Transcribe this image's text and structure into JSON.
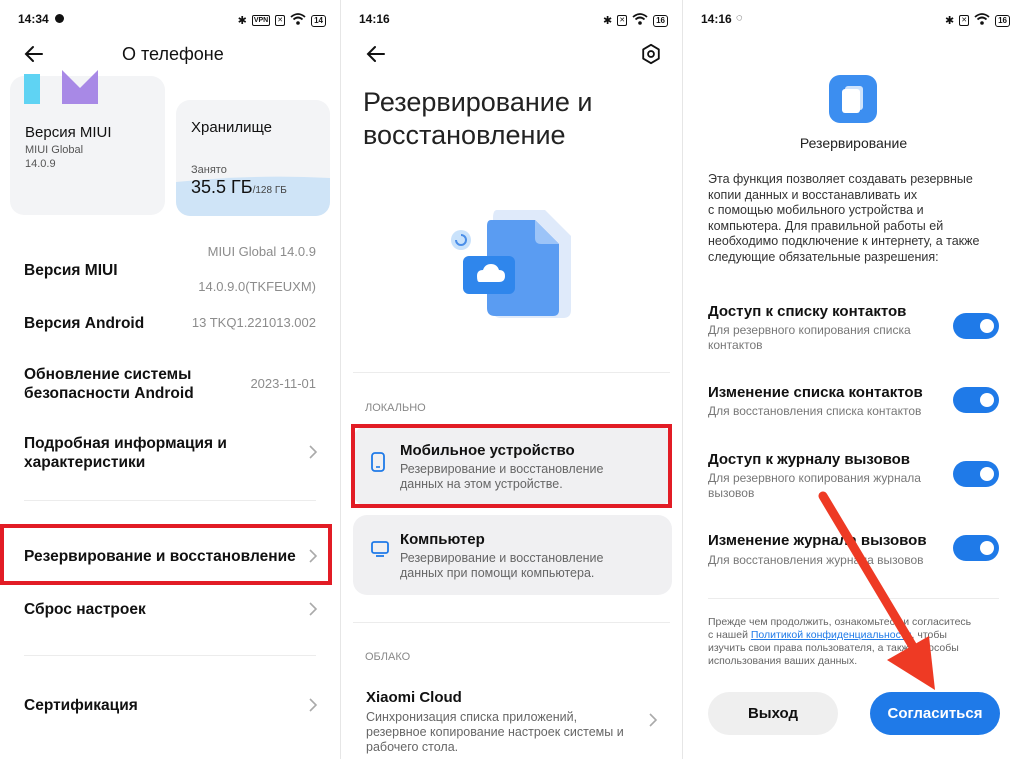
{
  "panel1": {
    "status": {
      "time": "14:34",
      "battery": "14",
      "vpn": "VPN"
    },
    "title": "О телефоне",
    "miui_card": {
      "title": "Версия MIUI",
      "line1": "MIUI Global",
      "line2": "14.0.9"
    },
    "storage_card": {
      "title": "Хранилище",
      "used_label": "Занято",
      "used_value": "35.5 ГБ",
      "total": "/128 ГБ",
      "used_fraction": 0.277
    },
    "rows": [
      {
        "title": "Версия MIUI",
        "value1": "MIUI Global 14.0.9",
        "value2": "14.0.9.0(TKFEUXM)"
      },
      {
        "title": "Версия Android",
        "value": "13 TKQ1.221013.002"
      },
      {
        "title1": "Обновление системы",
        "title2": "безопасности Android",
        "value": "2023-11-01"
      },
      {
        "title1": "Подробная информация и",
        "title2": "характеристики"
      },
      {
        "title": "Резервирование и восстановление"
      },
      {
        "title": "Сброс настроек"
      },
      {
        "title": "Сертификация"
      }
    ]
  },
  "panel2": {
    "status": {
      "time": "14:16",
      "battery": "16"
    },
    "title_line1": "Резервирование и",
    "title_line2": "восстановление",
    "section_local": "ЛОКАЛЬНО",
    "mobile": {
      "title": "Мобильное устройство",
      "desc1": "Резервирование и восстановление",
      "desc2": "данных на этом устройстве."
    },
    "computer": {
      "title": "Компьютер",
      "desc1": "Резервирование и восстановление",
      "desc2": "данных при помощи компьютера."
    },
    "section_cloud": "ОБЛАКО",
    "cloud": {
      "title": "Xiaomi Cloud",
      "desc1": "Синхронизация списка приложений,",
      "desc2": "резервное копирование настроек системы и",
      "desc3": "рабочего стола."
    }
  },
  "panel3": {
    "status": {
      "time": "14:16",
      "battery": "16"
    },
    "heading": "Резервирование",
    "intro": [
      "Эта функция позволяет создавать резервные",
      "копии данных и восстанавливать их",
      "с помощью мобильного устройства и",
      "компьютера. Для правильной работы ей",
      "необходимо подключение к интернету, а также",
      "следующие обязательные разрешения:"
    ],
    "permissions": [
      {
        "title": "Доступ к списку контактов",
        "desc1": "Для резервного копирования списка",
        "desc2": "контактов",
        "enabled": true
      },
      {
        "title": "Изменение списка контактов",
        "desc1": "Для восстановления списка контактов",
        "desc2": "",
        "enabled": true
      },
      {
        "title": "Доступ к журналу вызовов",
        "desc1": "Для резервного копирования журнала",
        "desc2": "вызовов",
        "enabled": true
      },
      {
        "title": "Изменение журнала вызовов",
        "desc1": "Для восстановления журнала вызовов",
        "desc2": "",
        "enabled": true
      }
    ],
    "footer_pre": "Прежде чем продолжить, ознакомьтесь и согласитесь",
    "footer_with": "с нашей ",
    "footer_link": "Политикой конфиденциальности",
    "footer_post": ", чтобы",
    "footer_l3": "изучить свои права пользователя, а также способы",
    "footer_l4": "использования ваших данных.",
    "exit_label": "Выход",
    "agree_label": "Согласиться"
  },
  "colors": {
    "accent": "#1f7ae8",
    "highlight": "#e21c25",
    "arrow": "#ee3a24"
  }
}
